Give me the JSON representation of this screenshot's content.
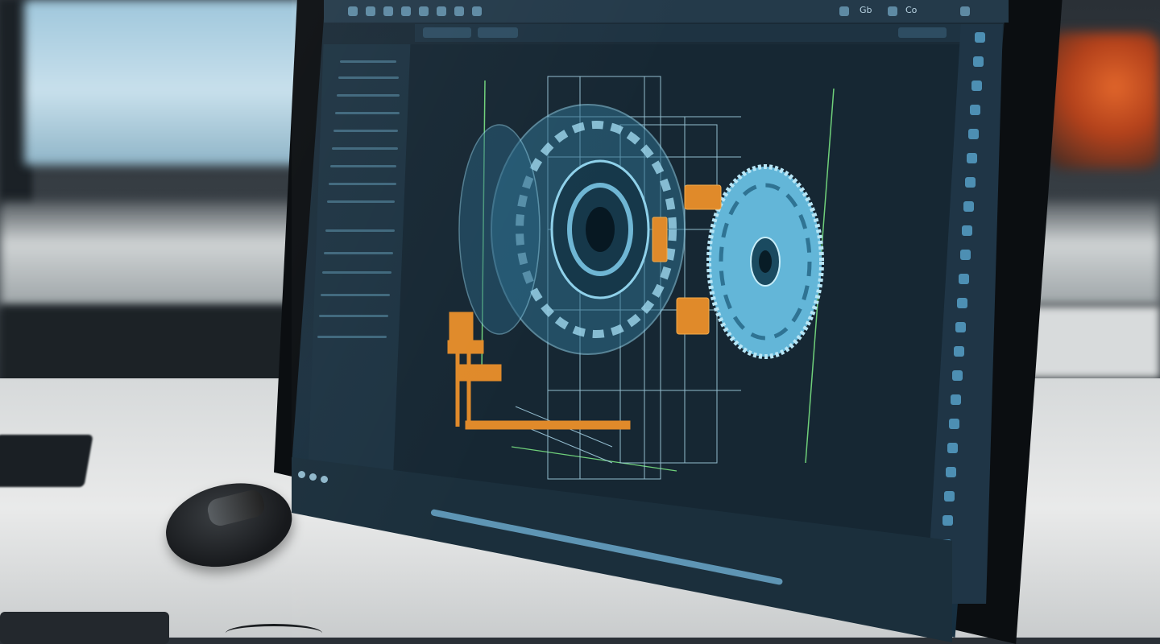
{
  "scene": "cad-workstation",
  "toolbar": {
    "buttons": [
      "file-icon",
      "save-icon",
      "undo-icon",
      "redo-icon",
      "select-icon",
      "move-icon",
      "rotate-icon",
      "measure-icon"
    ],
    "right_buttons": [
      "share-icon",
      "info-icon",
      "settings-icon"
    ],
    "label_a": "Gb",
    "label_b": "Co"
  },
  "colors": {
    "screen": "#1c3140",
    "panel": "#1d3342",
    "wireframe": "#7cc3df",
    "accent_parts": "#e08a2a",
    "axis_line": "#6fd07a"
  },
  "right_toolbar": {
    "button_count": 22
  },
  "taskbar": {
    "icons": [
      "start-icon",
      "browser-icon",
      "folder-icon"
    ]
  },
  "status": {
    "progress_fraction": 0.55
  }
}
